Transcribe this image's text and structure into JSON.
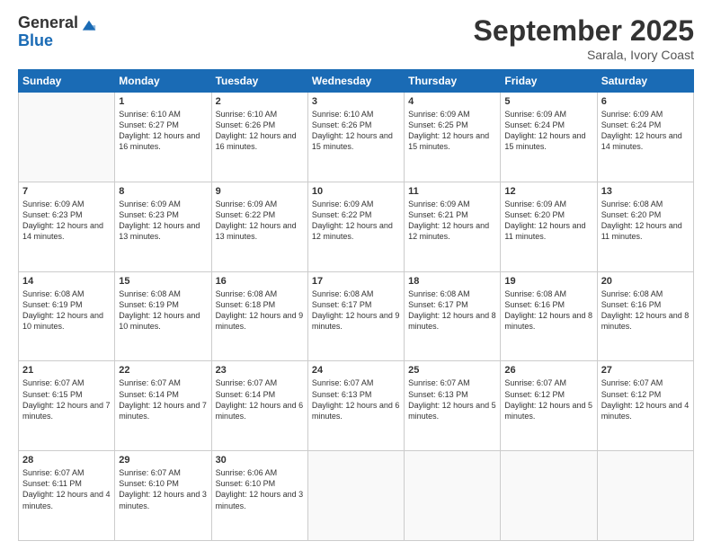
{
  "logo": {
    "general": "General",
    "blue": "Blue"
  },
  "header": {
    "month": "September 2025",
    "location": "Sarala, Ivory Coast"
  },
  "days_of_week": [
    "Sunday",
    "Monday",
    "Tuesday",
    "Wednesday",
    "Thursday",
    "Friday",
    "Saturday"
  ],
  "weeks": [
    [
      {
        "day": "",
        "sunrise": "",
        "sunset": "",
        "daylight": ""
      },
      {
        "day": "1",
        "sunrise": "Sunrise: 6:10 AM",
        "sunset": "Sunset: 6:27 PM",
        "daylight": "Daylight: 12 hours and 16 minutes."
      },
      {
        "day": "2",
        "sunrise": "Sunrise: 6:10 AM",
        "sunset": "Sunset: 6:26 PM",
        "daylight": "Daylight: 12 hours and 16 minutes."
      },
      {
        "day": "3",
        "sunrise": "Sunrise: 6:10 AM",
        "sunset": "Sunset: 6:26 PM",
        "daylight": "Daylight: 12 hours and 15 minutes."
      },
      {
        "day": "4",
        "sunrise": "Sunrise: 6:09 AM",
        "sunset": "Sunset: 6:25 PM",
        "daylight": "Daylight: 12 hours and 15 minutes."
      },
      {
        "day": "5",
        "sunrise": "Sunrise: 6:09 AM",
        "sunset": "Sunset: 6:24 PM",
        "daylight": "Daylight: 12 hours and 15 minutes."
      },
      {
        "day": "6",
        "sunrise": "Sunrise: 6:09 AM",
        "sunset": "Sunset: 6:24 PM",
        "daylight": "Daylight: 12 hours and 14 minutes."
      }
    ],
    [
      {
        "day": "7",
        "sunrise": "Sunrise: 6:09 AM",
        "sunset": "Sunset: 6:23 PM",
        "daylight": "Daylight: 12 hours and 14 minutes."
      },
      {
        "day": "8",
        "sunrise": "Sunrise: 6:09 AM",
        "sunset": "Sunset: 6:23 PM",
        "daylight": "Daylight: 12 hours and 13 minutes."
      },
      {
        "day": "9",
        "sunrise": "Sunrise: 6:09 AM",
        "sunset": "Sunset: 6:22 PM",
        "daylight": "Daylight: 12 hours and 13 minutes."
      },
      {
        "day": "10",
        "sunrise": "Sunrise: 6:09 AM",
        "sunset": "Sunset: 6:22 PM",
        "daylight": "Daylight: 12 hours and 12 minutes."
      },
      {
        "day": "11",
        "sunrise": "Sunrise: 6:09 AM",
        "sunset": "Sunset: 6:21 PM",
        "daylight": "Daylight: 12 hours and 12 minutes."
      },
      {
        "day": "12",
        "sunrise": "Sunrise: 6:09 AM",
        "sunset": "Sunset: 6:20 PM",
        "daylight": "Daylight: 12 hours and 11 minutes."
      },
      {
        "day": "13",
        "sunrise": "Sunrise: 6:08 AM",
        "sunset": "Sunset: 6:20 PM",
        "daylight": "Daylight: 12 hours and 11 minutes."
      }
    ],
    [
      {
        "day": "14",
        "sunrise": "Sunrise: 6:08 AM",
        "sunset": "Sunset: 6:19 PM",
        "daylight": "Daylight: 12 hours and 10 minutes."
      },
      {
        "day": "15",
        "sunrise": "Sunrise: 6:08 AM",
        "sunset": "Sunset: 6:19 PM",
        "daylight": "Daylight: 12 hours and 10 minutes."
      },
      {
        "day": "16",
        "sunrise": "Sunrise: 6:08 AM",
        "sunset": "Sunset: 6:18 PM",
        "daylight": "Daylight: 12 hours and 9 minutes."
      },
      {
        "day": "17",
        "sunrise": "Sunrise: 6:08 AM",
        "sunset": "Sunset: 6:17 PM",
        "daylight": "Daylight: 12 hours and 9 minutes."
      },
      {
        "day": "18",
        "sunrise": "Sunrise: 6:08 AM",
        "sunset": "Sunset: 6:17 PM",
        "daylight": "Daylight: 12 hours and 8 minutes."
      },
      {
        "day": "19",
        "sunrise": "Sunrise: 6:08 AM",
        "sunset": "Sunset: 6:16 PM",
        "daylight": "Daylight: 12 hours and 8 minutes."
      },
      {
        "day": "20",
        "sunrise": "Sunrise: 6:08 AM",
        "sunset": "Sunset: 6:16 PM",
        "daylight": "Daylight: 12 hours and 8 minutes."
      }
    ],
    [
      {
        "day": "21",
        "sunrise": "Sunrise: 6:07 AM",
        "sunset": "Sunset: 6:15 PM",
        "daylight": "Daylight: 12 hours and 7 minutes."
      },
      {
        "day": "22",
        "sunrise": "Sunrise: 6:07 AM",
        "sunset": "Sunset: 6:14 PM",
        "daylight": "Daylight: 12 hours and 7 minutes."
      },
      {
        "day": "23",
        "sunrise": "Sunrise: 6:07 AM",
        "sunset": "Sunset: 6:14 PM",
        "daylight": "Daylight: 12 hours and 6 minutes."
      },
      {
        "day": "24",
        "sunrise": "Sunrise: 6:07 AM",
        "sunset": "Sunset: 6:13 PM",
        "daylight": "Daylight: 12 hours and 6 minutes."
      },
      {
        "day": "25",
        "sunrise": "Sunrise: 6:07 AM",
        "sunset": "Sunset: 6:13 PM",
        "daylight": "Daylight: 12 hours and 5 minutes."
      },
      {
        "day": "26",
        "sunrise": "Sunrise: 6:07 AM",
        "sunset": "Sunset: 6:12 PM",
        "daylight": "Daylight: 12 hours and 5 minutes."
      },
      {
        "day": "27",
        "sunrise": "Sunrise: 6:07 AM",
        "sunset": "Sunset: 6:12 PM",
        "daylight": "Daylight: 12 hours and 4 minutes."
      }
    ],
    [
      {
        "day": "28",
        "sunrise": "Sunrise: 6:07 AM",
        "sunset": "Sunset: 6:11 PM",
        "daylight": "Daylight: 12 hours and 4 minutes."
      },
      {
        "day": "29",
        "sunrise": "Sunrise: 6:07 AM",
        "sunset": "Sunset: 6:10 PM",
        "daylight": "Daylight: 12 hours and 3 minutes."
      },
      {
        "day": "30",
        "sunrise": "Sunrise: 6:06 AM",
        "sunset": "Sunset: 6:10 PM",
        "daylight": "Daylight: 12 hours and 3 minutes."
      },
      {
        "day": "",
        "sunrise": "",
        "sunset": "",
        "daylight": ""
      },
      {
        "day": "",
        "sunrise": "",
        "sunset": "",
        "daylight": ""
      },
      {
        "day": "",
        "sunrise": "",
        "sunset": "",
        "daylight": ""
      },
      {
        "day": "",
        "sunrise": "",
        "sunset": "",
        "daylight": ""
      }
    ]
  ]
}
